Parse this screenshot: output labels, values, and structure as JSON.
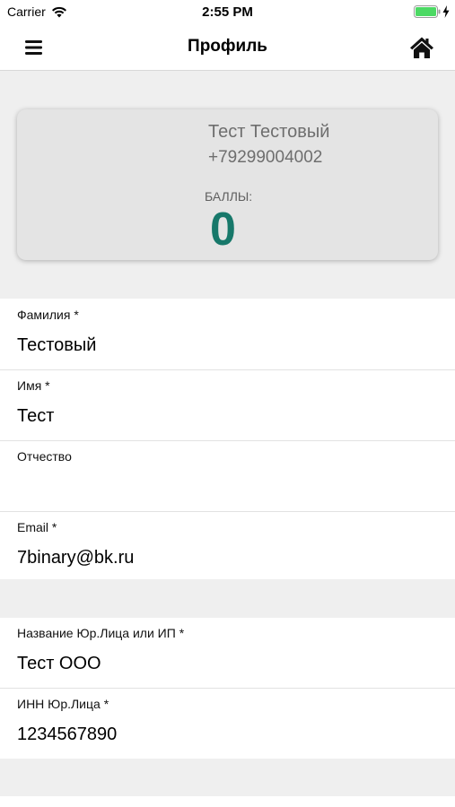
{
  "status_bar": {
    "carrier": "Carrier",
    "time": "2:55 PM"
  },
  "nav": {
    "title": "Профиль",
    "menu_icon": "menu-icon",
    "home_icon": "home-icon"
  },
  "profile": {
    "name": "Тест Тестовый",
    "phone": "+79299004002",
    "points_label": "БАЛЛЫ:",
    "points_value": "0"
  },
  "colors": {
    "accent": "#17786a",
    "battery": "#4cd964",
    "background": "#efefef",
    "card": "#e4e4e4"
  },
  "personal_fields": [
    {
      "label": "Фамилия *",
      "value": "Тестовый"
    },
    {
      "label": "Имя *",
      "value": "Тест"
    },
    {
      "label": "Отчество",
      "value": ""
    },
    {
      "label": "Email *",
      "value": "7binary@bk.ru"
    }
  ],
  "company_fields": [
    {
      "label": "Название Юр.Лица или ИП *",
      "value": "Тест ООО"
    },
    {
      "label": "ИНН Юр.Лица *",
      "value": "1234567890"
    }
  ]
}
